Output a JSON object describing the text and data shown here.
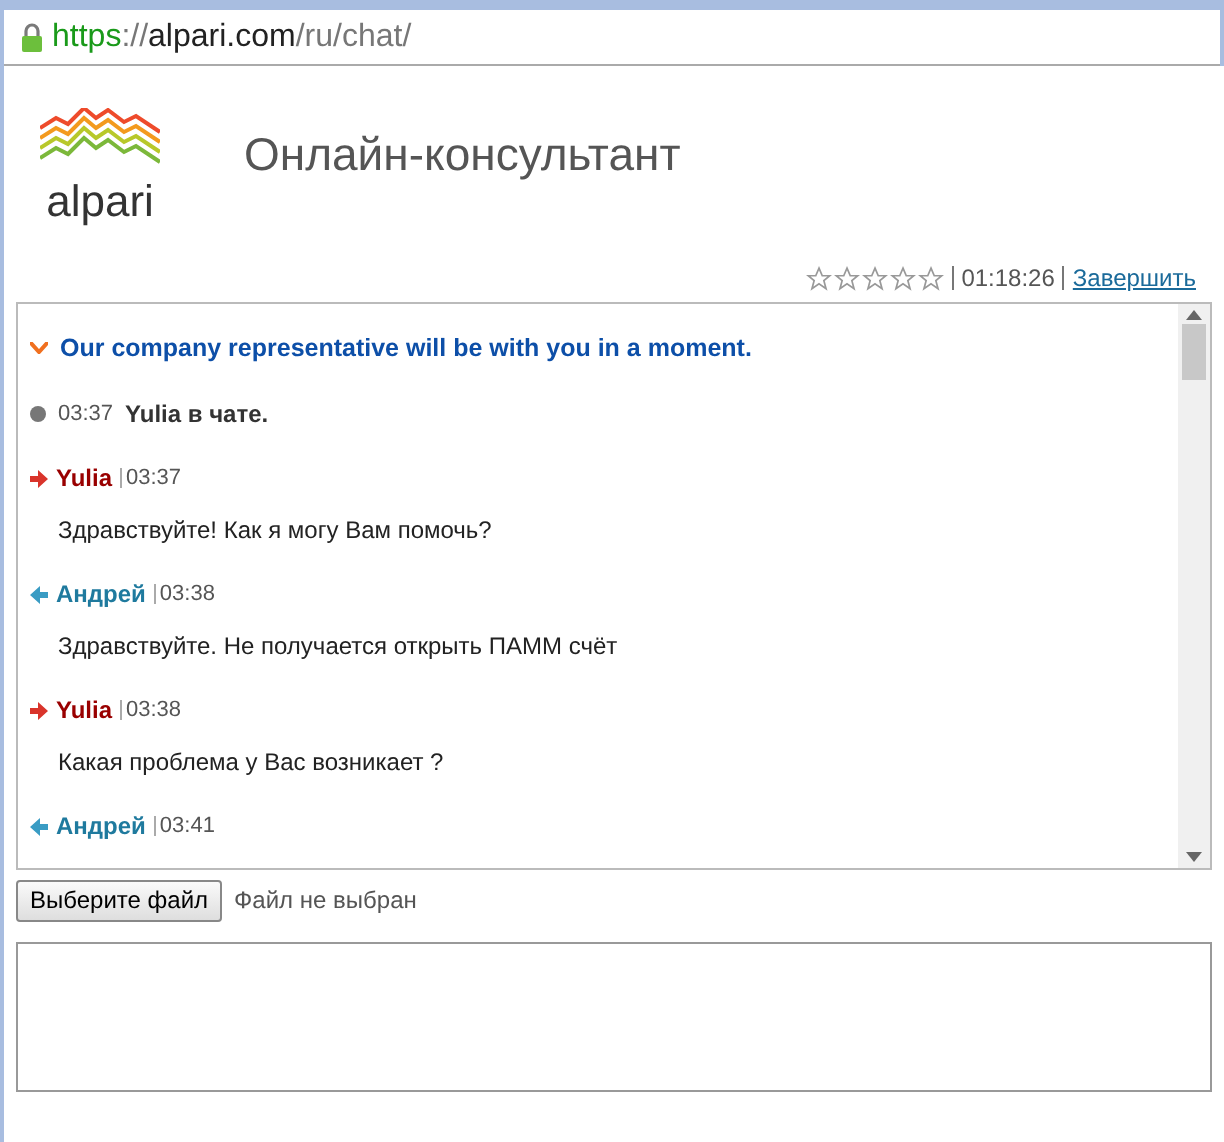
{
  "address_bar": {
    "scheme": "https",
    "separator": "://",
    "host": "alpari.com",
    "path": "/ru/chat/"
  },
  "header": {
    "title": "Онлайн-консультант",
    "logo_text": "alpari"
  },
  "session": {
    "stars": 0,
    "timer": "01:18:26",
    "end_link": "Завершить"
  },
  "messages": [
    {
      "kind": "system",
      "text": "Our company representative will be with you in a moment."
    },
    {
      "kind": "status",
      "time": "03:37",
      "text": "Yulia в чате."
    },
    {
      "kind": "incoming",
      "sender": "Yulia",
      "time": "03:37",
      "text": "Здравствуйте! Как я могу Вам помочь?"
    },
    {
      "kind": "outgoing",
      "sender": "Андрей",
      "time": "03:38",
      "text": "Здравствуйте. Не получается открыть ПАММ счёт"
    },
    {
      "kind": "incoming",
      "sender": "Yulia",
      "time": "03:38",
      "text": "Какая проблема у Вас возникает ?"
    },
    {
      "kind": "outgoing",
      "sender": "Андрей",
      "time": "03:41"
    }
  ],
  "file_picker": {
    "button": "Выберите файл",
    "status": "Файл не выбран"
  }
}
